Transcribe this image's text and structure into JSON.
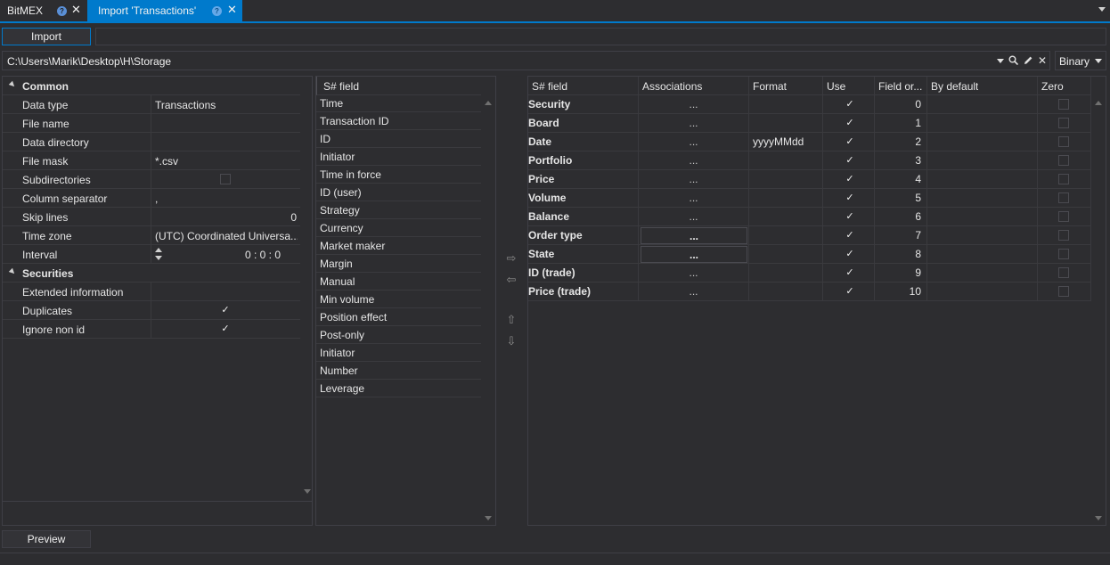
{
  "tabs": [
    {
      "label": "BitMEX",
      "active": false
    },
    {
      "label": "Import 'Transactions'",
      "active": true
    }
  ],
  "toolbar": {
    "import_label": "Import"
  },
  "path": {
    "value": "C:\\Users\\Marik\\Desktop\\H\\Storage",
    "icons": [
      "chevron-down-icon",
      "search-icon",
      "pencil-icon",
      "close-icon"
    ]
  },
  "format_select": {
    "value": "Binary"
  },
  "property_grid": {
    "common": {
      "label": "Common",
      "rows": [
        {
          "name": "Data type",
          "value": "Transactions"
        },
        {
          "name": "File name",
          "value": ""
        },
        {
          "name": "Data directory",
          "value": ""
        },
        {
          "name": "File mask",
          "value": "*.csv"
        },
        {
          "name": "Subdirectories",
          "value": "",
          "checkbox": false
        },
        {
          "name": "Column separator",
          "value": ","
        },
        {
          "name": "Skip lines",
          "value": "0"
        },
        {
          "name": "Time zone",
          "value": "(UTC) Coordinated Universa..."
        },
        {
          "name": "Interval",
          "value": "0 : 0 : 0"
        }
      ]
    },
    "securities": {
      "label": "Securities",
      "rows": [
        {
          "name": "Extended information",
          "value": ""
        },
        {
          "name": "Duplicates",
          "value": "",
          "checkbox": true
        },
        {
          "name": "Ignore non id",
          "value": "",
          "checkbox": true
        }
      ]
    }
  },
  "field_list": {
    "header": "S# field",
    "items": [
      "Time",
      "Transaction ID",
      "ID",
      "Initiator",
      "Time in force",
      "ID (user)",
      "Strategy",
      "Currency",
      "Market maker",
      "Margin",
      "Manual",
      "Min volume",
      "Position effect",
      "Post-only",
      "Initiator",
      "Number",
      "Leverage"
    ]
  },
  "arrows": {
    "move_right": "⇨",
    "move_left": "⇦",
    "move_up": "⇧",
    "move_down": "⇩"
  },
  "mapping_grid": {
    "headers": {
      "field": "S# field",
      "associations": "Associations",
      "format": "Format",
      "use": "Use",
      "order": "Field or...",
      "default": "By default",
      "zero": "Zero"
    },
    "rows": [
      {
        "field": "Security",
        "associations": "...",
        "format": "",
        "use": true,
        "order": "0",
        "zero": false
      },
      {
        "field": "Board",
        "associations": "...",
        "format": "",
        "use": true,
        "order": "1",
        "zero": false
      },
      {
        "field": "Date",
        "associations": "...",
        "format": "yyyyMMdd",
        "use": true,
        "order": "2",
        "zero": false
      },
      {
        "field": "Portfolio",
        "associations": "...",
        "format": "",
        "use": true,
        "order": "3",
        "zero": false
      },
      {
        "field": "Price",
        "associations": "...",
        "format": "",
        "use": true,
        "order": "4",
        "zero": false
      },
      {
        "field": "Volume",
        "associations": "...",
        "format": "",
        "use": true,
        "order": "5",
        "zero": false
      },
      {
        "field": "Balance",
        "associations": "...",
        "format": "",
        "use": true,
        "order": "6",
        "zero": false
      },
      {
        "field": "Order type",
        "associations": "...",
        "format": "",
        "use": true,
        "order": "7",
        "zero": false,
        "button": true
      },
      {
        "field": "State",
        "associations": "...",
        "format": "",
        "use": true,
        "order": "8",
        "zero": false,
        "button": true
      },
      {
        "field": "ID (trade)",
        "associations": "...",
        "format": "",
        "use": true,
        "order": "9",
        "zero": false
      },
      {
        "field": "Price (trade)",
        "associations": "...",
        "format": "",
        "use": true,
        "order": "10",
        "zero": false
      }
    ]
  },
  "bottom": {
    "preview_label": "Preview"
  },
  "colors": {
    "accent": "#007acc",
    "background": "#2d2d30",
    "border": "#3f3f46"
  }
}
